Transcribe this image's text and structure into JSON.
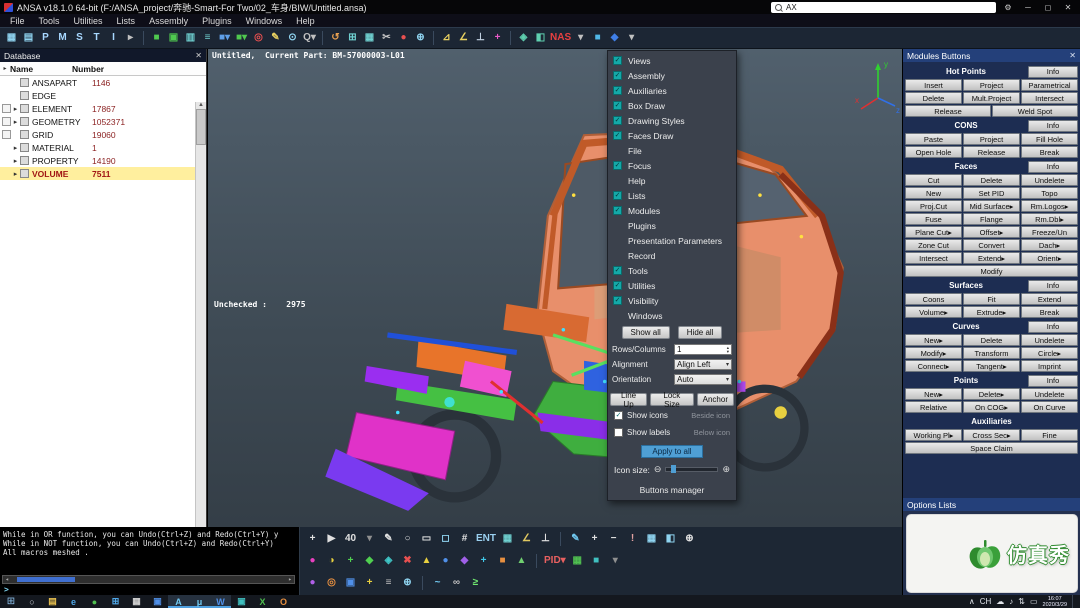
{
  "glyphs": {
    "close": "✕",
    "min": "─",
    "max": "◻",
    "gear": "⚙",
    "sort": "▸",
    "scroll_up": "▲",
    "scroll_down": "▼",
    "scroll_left": "◂",
    "scroll_right": "▸",
    "spin_up": "▴",
    "spin_down": "▾",
    "dropdown": "▾",
    "prompt": ">",
    "start": "⊞",
    "search_circle": "○",
    "mag_minus": "⊖",
    "mag_plus": "⊕"
  },
  "title_bar": {
    "title": "ANSA v18.1.0 64-bit (F:/ANSA_project/奔驰-Smart-For Two/02_车身/BIW/Untitled.ansa)",
    "search_text": "AX"
  },
  "menu_bar": {
    "items": [
      "File",
      "Tools",
      "Utilities",
      "Lists",
      "Assembly",
      "Plugins",
      "Windows",
      "Help"
    ]
  },
  "top_toolbar": {
    "icons": [
      {
        "name": "windows-layout-icon",
        "glyph": "▦",
        "color": "#8fd4f0"
      },
      {
        "name": "entity-manager-icon",
        "glyph": "▤",
        "color": "#8fd4f0"
      },
      {
        "name": "pid-list-icon",
        "glyph": "P",
        "color": "#a8d8ff"
      },
      {
        "name": "material-list-icon",
        "glyph": "M",
        "color": "#a8d8ff"
      },
      {
        "name": "set-list-icon",
        "glyph": "S",
        "color": "#a8d8ff"
      },
      {
        "name": "type-list-icon",
        "glyph": "T",
        "color": "#a8d8ff"
      },
      {
        "name": "include-list-icon",
        "glyph": "I",
        "color": "#a8d8ff"
      },
      {
        "name": "expand-more-icon",
        "glyph": "▸",
        "color": "#c0c0c0"
      },
      {
        "name": "separator",
        "sep": true
      },
      {
        "name": "compress-icon",
        "glyph": "■",
        "color": "#4fc94f"
      },
      {
        "name": "database-browser-icon",
        "glyph": "▣",
        "color": "#4fc94f"
      },
      {
        "name": "screen-icon",
        "glyph": "▥",
        "color": "#6fd0d0"
      },
      {
        "name": "list-icon",
        "glyph": "≡",
        "color": "#6fd0d0"
      },
      {
        "name": "volume-menu-icon",
        "glyph": "■▾",
        "color": "#5f9fe8"
      },
      {
        "name": "faces-menu-icon",
        "glyph": "■▾",
        "color": "#4fc94f"
      },
      {
        "name": "focus-icon",
        "glyph": "◎",
        "color": "#e85050"
      },
      {
        "name": "draw-pencil-icon",
        "glyph": "✎",
        "color": "#e8d060"
      },
      {
        "name": "locate-icon",
        "glyph": "⊙",
        "color": "#8fd4f0"
      },
      {
        "name": "query-menu-icon",
        "glyph": "Q▾",
        "color": "#c0c0c0"
      },
      {
        "name": "separator",
        "sep": true
      },
      {
        "name": "undo-icon",
        "glyph": "↺",
        "color": "#e8a050"
      },
      {
        "name": "grid-add-icon",
        "glyph": "⊞",
        "color": "#6fd0d0"
      },
      {
        "name": "table-icon",
        "glyph": "▦",
        "color": "#6fd0d0"
      },
      {
        "name": "cut-icon",
        "glyph": "✂",
        "color": "#c8c8c8"
      },
      {
        "name": "record-icon",
        "glyph": "●",
        "color": "#e85050"
      },
      {
        "name": "zoom-in-icon",
        "glyph": "⊕",
        "color": "#8fd4f0"
      },
      {
        "name": "separator",
        "sep": true
      },
      {
        "name": "measure-icon",
        "glyph": "⊿",
        "color": "#e8d060"
      },
      {
        "name": "angle-icon",
        "glyph": "∠",
        "color": "#e8d060"
      },
      {
        "name": "align-icon",
        "glyph": "⊥",
        "color": "#c0d0e0"
      },
      {
        "name": "axes-icon",
        "glyph": "+",
        "color": "#e858c8"
      },
      {
        "name": "separator",
        "sep": true
      },
      {
        "name": "nodes-icon",
        "glyph": "◈",
        "color": "#5fd0b0"
      },
      {
        "name": "shell-icon",
        "glyph": "◧",
        "color": "#5fd0b0"
      },
      {
        "name": "nastran-deck-icon",
        "glyph": "NAS",
        "color": "#e84040"
      },
      {
        "name": "deck-menu-icon",
        "glyph": "▾",
        "color": "#c0c0c0"
      },
      {
        "name": "solid-icon",
        "glyph": "■",
        "color": "#50b8e8"
      },
      {
        "name": "mesh-icon",
        "glyph": "◆",
        "color": "#3f7fe8"
      },
      {
        "name": "more-icon",
        "glyph": "▾",
        "color": "#c0c0c0"
      }
    ]
  },
  "database_panel": {
    "title": "Database",
    "columns": [
      "Name",
      "Number"
    ],
    "rows": [
      {
        "name": "ANSAPART",
        "number": "1146",
        "expand": false,
        "box": false,
        "selected": false
      },
      {
        "name": "EDGE",
        "number": "",
        "expand": false,
        "box": false,
        "selected": false
      },
      {
        "name": "ELEMENT",
        "number": "17867",
        "expand": true,
        "box": true,
        "selected": false
      },
      {
        "name": "GEOMETRY",
        "number": "1052371",
        "expand": true,
        "box": true,
        "selected": false
      },
      {
        "name": "GRID",
        "number": "19060",
        "expand": false,
        "box": true,
        "selected": false
      },
      {
        "name": "MATERIAL",
        "number": "1",
        "expand": true,
        "box": false,
        "selected": false
      },
      {
        "name": "PROPERTY",
        "number": "14190",
        "expand": true,
        "box": false,
        "selected": false
      },
      {
        "name": "VOLUME",
        "number": "7511",
        "expand": true,
        "box": false,
        "selected": true
      }
    ]
  },
  "viewport": {
    "header_text": "Untitled,  Current Part: BM-57000003-L01",
    "unchecked_label": "Unchecked :    2975",
    "triad": {
      "x": "x",
      "y": "y",
      "z": "z"
    }
  },
  "popup_menu": {
    "items": [
      {
        "label": "Views",
        "checked": true
      },
      {
        "label": "Assembly",
        "checked": true
      },
      {
        "label": "Auxiliaries",
        "checked": true
      },
      {
        "label": "Box Draw",
        "checked": true
      },
      {
        "label": "Drawing Styles",
        "checked": true
      },
      {
        "label": "Faces Draw",
        "checked": true
      },
      {
        "label": "File",
        "checked": false
      },
      {
        "label": "Focus",
        "checked": true
      },
      {
        "label": "Help",
        "checked": false
      },
      {
        "label": "Lists",
        "checked": true
      },
      {
        "label": "Modules",
        "checked": true
      },
      {
        "label": "Plugins",
        "checked": false
      },
      {
        "label": "Presentation Parameters",
        "checked": false
      },
      {
        "label": "Record",
        "checked": false
      },
      {
        "label": "Tools",
        "checked": true
      },
      {
        "label": "Utilities",
        "checked": true
      },
      {
        "label": "Visibility",
        "checked": true
      },
      {
        "label": "Windows",
        "checked": false
      }
    ],
    "show_all": "Show all",
    "hide_all": "Hide all",
    "fields": [
      {
        "label": "Rows/Columns",
        "value": "1",
        "is_spin": true
      },
      {
        "label": "Alignment",
        "value": "Align Left",
        "is_spin": false
      },
      {
        "label": "Orientation",
        "value": "Auto",
        "is_spin": false
      }
    ],
    "action_buttons": [
      "Line Up",
      "Lock Size",
      "Anchor"
    ],
    "toggles": [
      {
        "label": "Show icons",
        "checked": true,
        "sub": "Beside icon"
      },
      {
        "label": "Show labels",
        "checked": false,
        "sub": "Below icon"
      }
    ],
    "apply": "Apply to all",
    "icon_size_label": "Icon size:",
    "manager": "Buttons manager"
  },
  "modules_panel": {
    "title": "Modules Buttons",
    "groups": [
      {
        "header": "Hot Points",
        "info": "Info",
        "no_info": false,
        "rows": [
          [
            "Insert",
            "Project",
            "Parametrical"
          ],
          [
            "Delete",
            "Mult.Project",
            "Intersect"
          ],
          [
            "Release",
            "Weld Spot"
          ]
        ]
      },
      {
        "header": "CONS",
        "info": "Info",
        "no_info": false,
        "rows": [
          [
            "Paste",
            "Project",
            "Fill Hole"
          ],
          [
            "Open Hole",
            "Release",
            "Break"
          ]
        ]
      },
      {
        "header": "Faces",
        "info": "Info",
        "no_info": false,
        "rows": [
          [
            "Cut",
            "Delete",
            "Undelete"
          ],
          [
            "New",
            "Set PID",
            "Topo"
          ],
          [
            "Proj.Cut",
            "Mid Surface▸",
            "Rm.Logos▸"
          ],
          [
            "Fuse",
            "Flange",
            "Rm.Dbl▸"
          ],
          [
            "Plane Cut▸",
            "Offset▸",
            "Freeze/Un"
          ],
          [
            "Zone Cut",
            "Convert",
            "Dach▸"
          ],
          [
            "Intersect",
            "Extend▸",
            "Orient▸"
          ],
          [
            "Modify"
          ]
        ]
      },
      {
        "header": "Surfaces",
        "info": "Info",
        "no_info": false,
        "rows": [
          [
            "Coons",
            "Fit",
            "Extend"
          ],
          [
            "Volume▸",
            "Extrude▸",
            "Break"
          ]
        ]
      },
      {
        "header": "Curves",
        "info": "Info",
        "no_info": false,
        "rows": [
          [
            "New▸",
            "Delete",
            "Undelete"
          ],
          [
            "Modify▸",
            "Transform",
            "Circle▸"
          ],
          [
            "Connect▸",
            "Tangent▸",
            "Imprint"
          ]
        ]
      },
      {
        "header": "Points",
        "info": "Info",
        "no_info": false,
        "rows": [
          [
            "New▸",
            "Delete▸",
            "Undelete"
          ],
          [
            "Relative",
            "On COG▸",
            "On Curve"
          ]
        ]
      },
      {
        "header": "Auxiliaries",
        "info": "",
        "no_info": true,
        "rows": [
          [
            "Working Pl▸",
            "Cross Sec▸",
            "Fine"
          ],
          [
            "Space Claim"
          ]
        ]
      }
    ]
  },
  "options_panel": {
    "title": "Options Lists",
    "watermark": "仿真秀"
  },
  "console": {
    "lines": [
      "While in OR function, you can Undo(Ctrl+Z) and Redo(Ctrl+Y) y",
      "While in NOT function, you can Undo(Ctrl+Z) and Redo(Ctrl+Y)",
      "All macros meshed ."
    ],
    "prompt": ">"
  },
  "bottom_toolbar": {
    "row1": [
      {
        "name": "crosshair-icon",
        "glyph": "+",
        "color": "#e0e0e0"
      },
      {
        "name": "select-arrow-icon",
        "glyph": "▶",
        "color": "#e0e0e0"
      },
      {
        "name": "density-value",
        "glyph": "40",
        "color": "#e0e0e0"
      },
      {
        "name": "density-dropdown-icon",
        "glyph": "▾",
        "color": "#909090"
      },
      {
        "name": "pen-icon",
        "glyph": "✎",
        "color": "#e0e0e0"
      },
      {
        "name": "circle-tool-icon",
        "glyph": "○",
        "color": "#e0e0e0"
      },
      {
        "name": "rect-tool-icon",
        "glyph": "▭",
        "color": "#e0e0e0"
      },
      {
        "name": "plane-tool-icon",
        "glyph": "◻",
        "color": "#8fd4f0"
      },
      {
        "name": "hatch-tool-icon",
        "glyph": "#",
        "color": "#e0e0e0"
      },
      {
        "name": "ent-mode-label",
        "glyph": "ENT",
        "color": "#9ad0f0"
      },
      {
        "name": "grid-tool-icon",
        "glyph": "▦",
        "color": "#6fd0d0"
      },
      {
        "name": "angle-tool-icon",
        "glyph": "∠",
        "color": "#e0c860"
      },
      {
        "name": "perpendicular-icon",
        "glyph": "⊥",
        "color": "#e0e0e0"
      },
      {
        "name": "separator",
        "sep": true
      },
      {
        "name": "sketch-pencil-icon",
        "glyph": "✎",
        "color": "#70c8f0"
      },
      {
        "name": "add-icon",
        "glyph": "+",
        "color": "#e0e0e0"
      },
      {
        "name": "remove-icon",
        "glyph": "−",
        "color": "#e0e0e0"
      },
      {
        "name": "warn-icon",
        "glyph": "!",
        "color": "#e0a0a0"
      },
      {
        "name": "mesh-cube-icon",
        "glyph": "▦",
        "color": "#8fd4f0"
      },
      {
        "name": "shell-cube-icon",
        "glyph": "◧",
        "color": "#8fd4f0"
      },
      {
        "name": "anchor-target-icon",
        "glyph": "⊕",
        "color": "#e0e0e0"
      }
    ],
    "row2": [
      {
        "name": "point-magenta-icon",
        "glyph": "●",
        "color": "#e840c0"
      },
      {
        "name": "half-yellow-icon",
        "glyph": "◑",
        "color": "#e8d040"
      },
      {
        "name": "plus-green-icon",
        "glyph": "+",
        "color": "#50d050"
      },
      {
        "name": "diamond-green-icon",
        "glyph": "◆",
        "color": "#50d050"
      },
      {
        "name": "diamond-teal-icon",
        "glyph": "◈",
        "color": "#40c8c8"
      },
      {
        "name": "cross-red-icon",
        "glyph": "✖",
        "color": "#e85050"
      },
      {
        "name": "triangle-yellow-icon",
        "glyph": "▲",
        "color": "#e8d040"
      },
      {
        "name": "dot-blue-icon",
        "glyph": "●",
        "color": "#5090e8"
      },
      {
        "name": "diamond-purple-icon",
        "glyph": "◆",
        "color": "#a060e8"
      },
      {
        "name": "plus-cyan-icon",
        "glyph": "+",
        "color": "#40c8e8"
      },
      {
        "name": "square-orange-icon",
        "glyph": "■",
        "color": "#e89040"
      },
      {
        "name": "triangle-green-icon",
        "glyph": "▲",
        "color": "#70d070"
      },
      {
        "name": "separator",
        "sep": true
      },
      {
        "name": "pid-menu-icon",
        "glyph": "PID▾",
        "color": "#e86060"
      },
      {
        "name": "mesh-green-icon",
        "glyph": "▦",
        "color": "#50c050"
      },
      {
        "name": "cube-teal-icon",
        "glyph": "■",
        "color": "#40c0c0"
      },
      {
        "name": "tools-dropdown-icon",
        "glyph": "▾",
        "color": "#909090"
      }
    ],
    "row3": [
      {
        "name": "dot-purple-icon",
        "glyph": "●",
        "color": "#b060e8"
      },
      {
        "name": "ring-orange-icon",
        "glyph": "◎",
        "color": "#e89040"
      },
      {
        "name": "cube-blue-icon",
        "glyph": "▣",
        "color": "#5090e8"
      },
      {
        "name": "plus-yellow-icon",
        "glyph": "+",
        "color": "#e8d040"
      },
      {
        "name": "list-small-icon",
        "glyph": "≡",
        "color": "#c0c0c0"
      },
      {
        "name": "target-small-icon",
        "glyph": "⊕",
        "color": "#8fd4f0"
      },
      {
        "name": "separator",
        "sep": true
      },
      {
        "name": "wave-icon",
        "glyph": "~",
        "color": "#70c8f0"
      },
      {
        "name": "link-icon",
        "glyph": "∞",
        "color": "#c0c0c0"
      },
      {
        "name": "greater-icon",
        "glyph": "≥",
        "color": "#70e870"
      }
    ]
  },
  "taskbar": {
    "apps": [
      {
        "name": "file-explorer-icon",
        "glyph": "▤",
        "color": "#e8c050",
        "open": false
      },
      {
        "name": "edge-browser-icon",
        "glyph": "e",
        "color": "#50a8e8",
        "open": false
      },
      {
        "name": "green-app-icon",
        "glyph": "●",
        "color": "#50c050",
        "open": false
      },
      {
        "name": "grid-app-icon",
        "glyph": "⊞",
        "color": "#50a8e8",
        "open": false
      },
      {
        "name": "calculator-icon",
        "glyph": "▦",
        "color": "#d0d0d0",
        "open": false
      },
      {
        "name": "photos-icon",
        "glyph": "▣",
        "color": "#5090e8",
        "open": false
      },
      {
        "name": "ansa-icon",
        "glyph": "A",
        "color": "#70c8f0",
        "open": true
      },
      {
        "name": "meta-icon",
        "glyph": "μ",
        "color": "#70c8f0",
        "open": true
      },
      {
        "name": "word-icon",
        "glyph": "W",
        "color": "#5090e8",
        "open": true
      },
      {
        "name": "image-app-icon",
        "glyph": "▣",
        "color": "#40c0c0",
        "open": false
      },
      {
        "name": "excel-icon",
        "glyph": "X",
        "color": "#50c050",
        "open": false
      },
      {
        "name": "powerpoint-icon",
        "glyph": "O",
        "color": "#e89040",
        "open": false
      }
    ],
    "tray": [
      {
        "name": "tray-expand-icon",
        "glyph": "∧"
      },
      {
        "name": "ime-language",
        "glyph": "CH"
      },
      {
        "name": "cloud-icon",
        "glyph": "☁"
      },
      {
        "name": "sound-icon",
        "glyph": "♪"
      },
      {
        "name": "network-icon",
        "glyph": "⇅"
      },
      {
        "name": "battery-icon",
        "glyph": "▭"
      }
    ],
    "time": "16:07",
    "date": "2020/3/29"
  }
}
